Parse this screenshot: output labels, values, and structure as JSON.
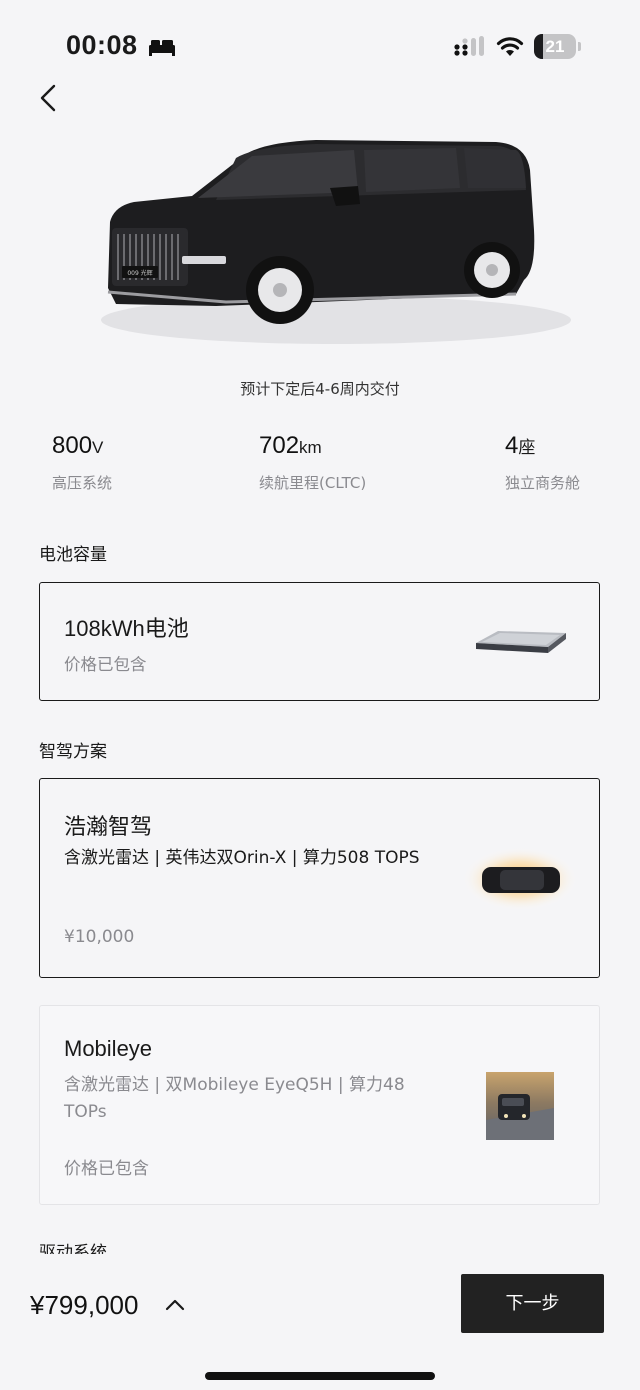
{
  "status_bar": {
    "time": "00:08",
    "battery_level": "21"
  },
  "delivery_note": "预计下定后4-6周内交付",
  "specs": [
    {
      "value": "800",
      "unit": "V",
      "label": "高压系统"
    },
    {
      "value": "702",
      "unit": "km",
      "label": "续航里程(CLTC)"
    },
    {
      "value": "4",
      "unit": "座",
      "label": "独立商务舱"
    }
  ],
  "vehicle": {
    "plate": "009 光辉"
  },
  "battery_section": {
    "title": "电池容量",
    "option": {
      "title": "108kWh电池",
      "subtitle": "价格已包含"
    }
  },
  "adas_section": {
    "title": "智驾方案",
    "options": [
      {
        "title": "浩瀚智驾",
        "description": "含激光雷达 | 英伟达双Orin-X | 算力508 TOPS",
        "price": "¥10,000",
        "selected": true
      },
      {
        "title": "Mobileye",
        "description": "含激光雷达 | 双Mobileye EyeQ5H | 算力48 TOPs",
        "price": "价格已包含",
        "selected": false
      }
    ]
  },
  "drive_section": {
    "title": "驱动系统"
  },
  "footer": {
    "total_price": "¥799,000",
    "next_label": "下一步"
  },
  "colors": {
    "accent": "#222222",
    "background": "#f5f5f7",
    "muted_text": "#8a8a8f"
  }
}
